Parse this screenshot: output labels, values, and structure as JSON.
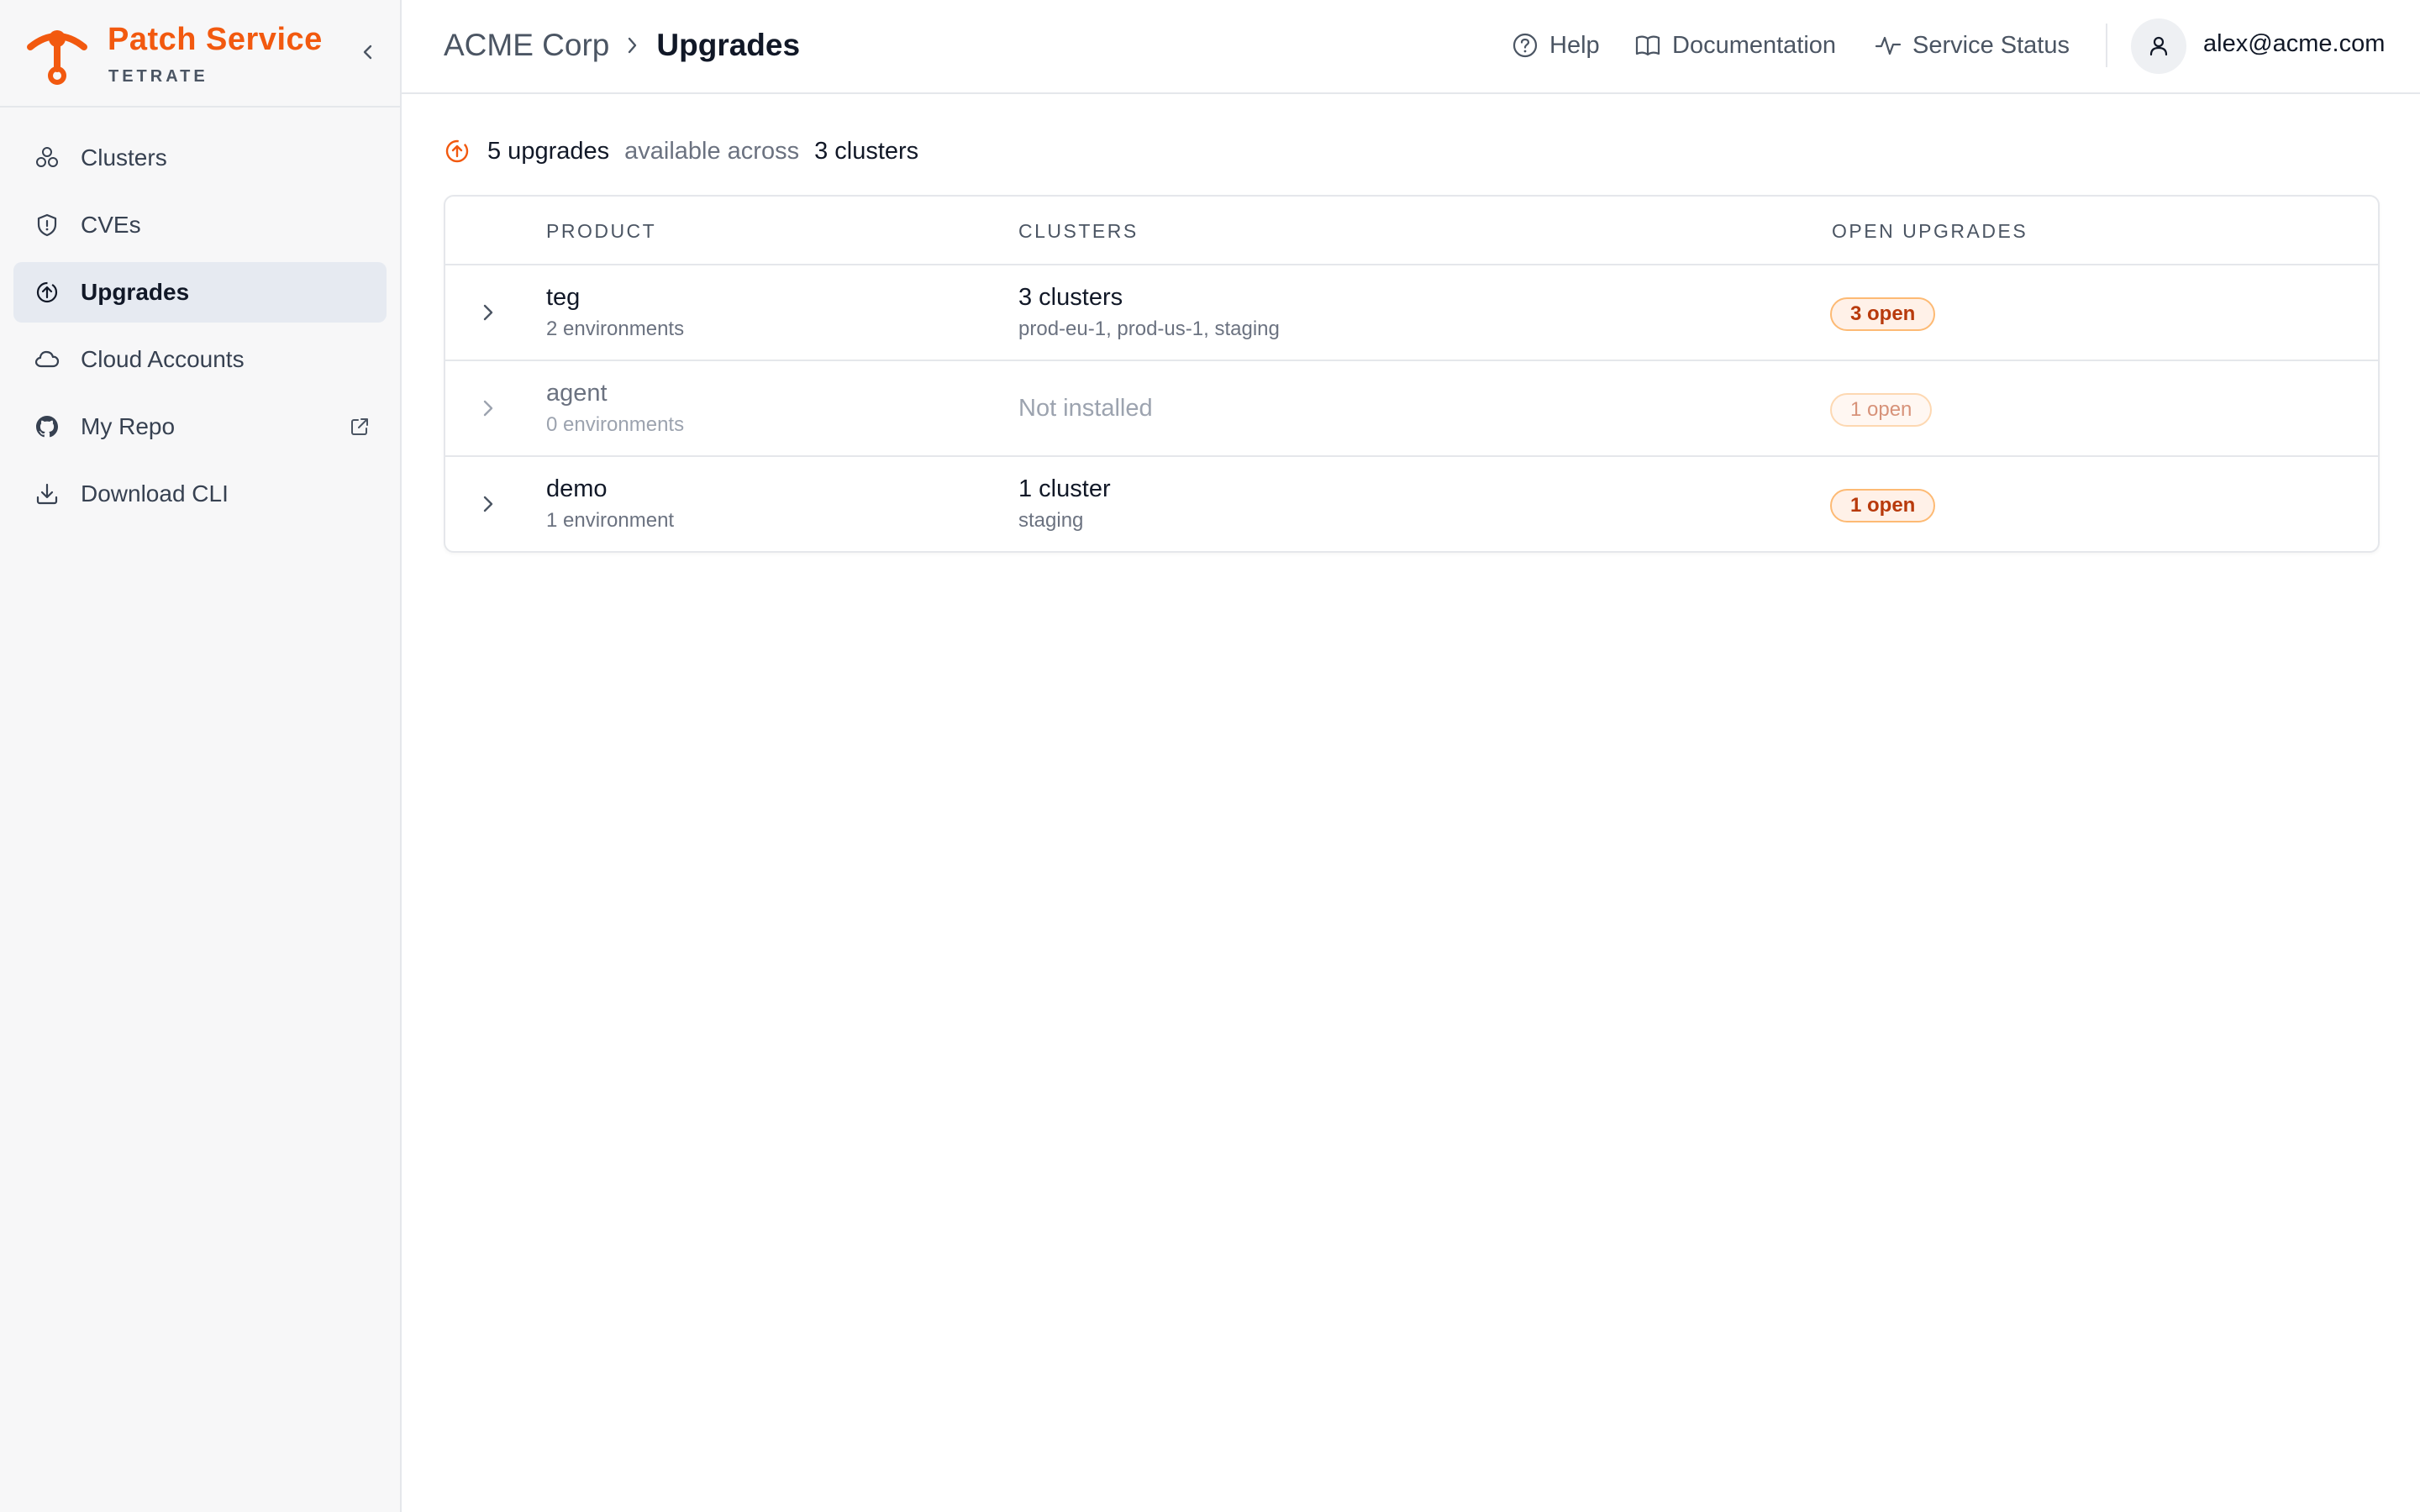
{
  "app": {
    "name": "Patch Service",
    "vendor": "TETRATE",
    "brand_color": "#f2590f"
  },
  "sidebar": {
    "items": [
      {
        "label": "Clusters",
        "icon": "clusters-icon"
      },
      {
        "label": "CVEs",
        "icon": "shield-icon"
      },
      {
        "label": "Upgrades",
        "icon": "upgrade-icon",
        "active": true
      },
      {
        "label": "Cloud Accounts",
        "icon": "cloud-icon"
      },
      {
        "label": "My Repo",
        "icon": "github-icon",
        "external": true
      },
      {
        "label": "Download CLI",
        "icon": "download-icon"
      }
    ]
  },
  "header": {
    "breadcrumb": {
      "org": "ACME Corp",
      "page": "Upgrades"
    },
    "links": {
      "help": "Help",
      "documentation": "Documentation",
      "service_status": "Service Status"
    },
    "user_email": "alex@acme.com"
  },
  "summary": {
    "upgrades": "5 upgrades",
    "middle": "available across",
    "clusters": "3 clusters"
  },
  "table": {
    "columns": {
      "product": "PRODUCT",
      "clusters": "CLUSTERS",
      "open_upgrades": "OPEN UPGRADES"
    },
    "rows": [
      {
        "product": "teg",
        "environments": "2 environments",
        "clusters": "3 clusters",
        "cluster_list": "prod-eu-1, prod-us-1, staging",
        "open": "3 open"
      },
      {
        "product": "agent",
        "environments": "0 environments",
        "clusters": "Not installed",
        "cluster_list": "",
        "open": "1 open"
      },
      {
        "product": "demo",
        "environments": "1 environment",
        "clusters": "1 cluster",
        "cluster_list": "staging",
        "open": "1 open"
      }
    ]
  }
}
